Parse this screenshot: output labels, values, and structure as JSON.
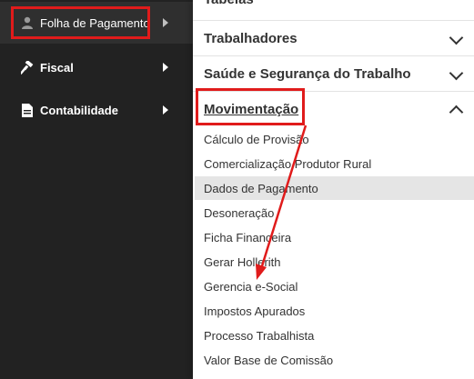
{
  "sidebar": {
    "items": [
      {
        "label": "Folha de Pagamento",
        "icon": "person-icon",
        "active": true
      },
      {
        "label": "Fiscal",
        "icon": "gavel-icon"
      },
      {
        "label": "Contabilidade",
        "icon": "document-icon"
      }
    ]
  },
  "submenu": {
    "cut_heading": "Tabelas",
    "sections": [
      {
        "label": "Trabalhadores",
        "expanded": false
      },
      {
        "label": "Saúde e Segurança do Trabalho",
        "expanded": false
      },
      {
        "label": "Movimentação",
        "expanded": true
      }
    ],
    "items": [
      "Cálculo de Provisão",
      "Comercialização Produtor Rural",
      "Dados de Pagamento",
      "Desoneração",
      "Ficha Financeira",
      "Gerar Hollerith",
      "Gerencia e-Social",
      "Impostos Apurados",
      "Processo Trabalhista",
      "Valor Base de Comissão"
    ],
    "hovered_item": "Dados de Pagamento"
  },
  "colors": {
    "highlight": "#e01b1b",
    "sidebar_bg": "#222222",
    "panel_bg": "#ffffff"
  }
}
